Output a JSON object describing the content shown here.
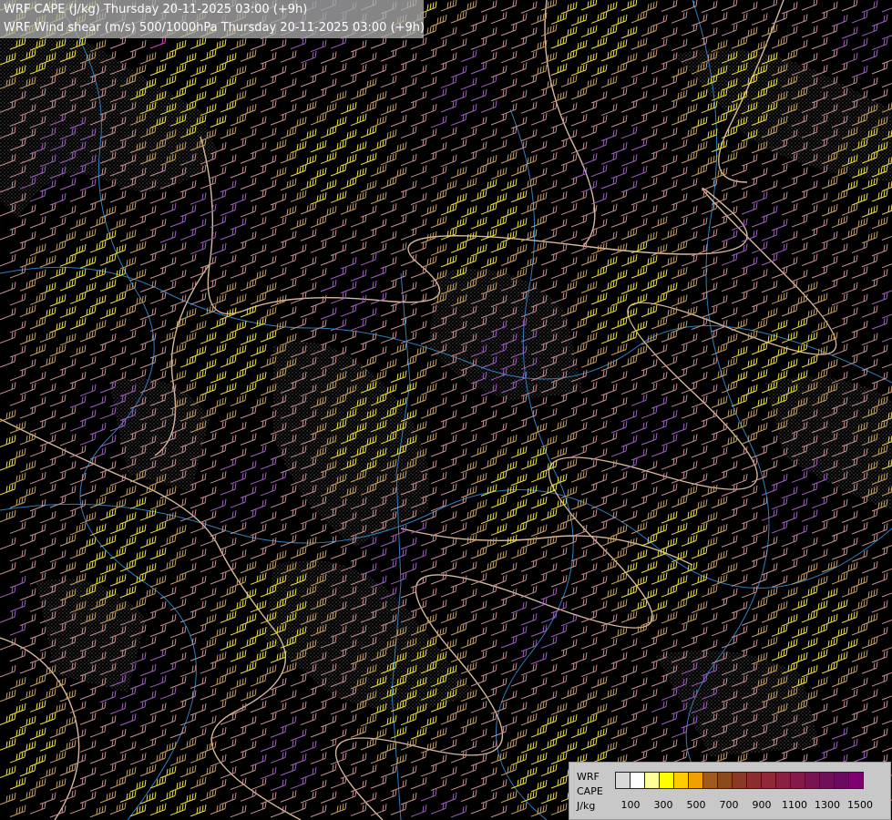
{
  "title": {
    "line1": "WRF CAPE (J/kg) Thursday 20-11-2025 03:00 (+9h)",
    "line2": "WRF Wind shear (m/s) 500/1000hPa Thursday 20-11-2025 03:00 (+9h)"
  },
  "legend": {
    "label_model": "WRF",
    "label_field": "CAPE",
    "label_unit": "J/kg",
    "swatches": [
      "#d8d8d8",
      "#ffffff",
      "#ffff99",
      "#ffff00",
      "#ffcc00",
      "#f0a000",
      "#a05a1e",
      "#8c4a1a",
      "#8a3a24",
      "#8a2c30",
      "#902838",
      "#8c2040",
      "#841a48",
      "#7a1450",
      "#701058",
      "#6a0a60",
      "#800070"
    ],
    "ticks": [
      "100",
      "300",
      "500",
      "700",
      "900",
      "1100",
      "1300",
      "1500"
    ]
  },
  "map_colors": {
    "background": "#000000",
    "river": "#2f7fbf",
    "border": "#d8b89a",
    "barb_pink": "#c89090",
    "barb_tan": "#c8a060",
    "barb_yellow": "#f0e040",
    "barb_violet": "#a060c0",
    "barb_magenta": "#e040c0",
    "barb_red": "#e05050",
    "terrain": "#3a3a3a"
  }
}
